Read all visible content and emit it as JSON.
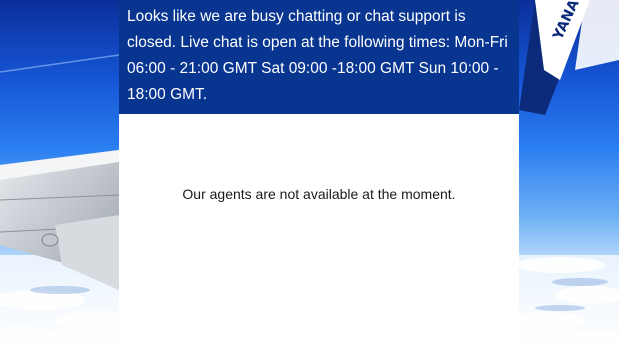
{
  "chat": {
    "closed_message": " Looks like we are busy chatting or chat support is closed. Live chat is open at the following times: Mon-Fri 06:00 - 21:00 GMT Sat 09:00 -18:00 GMT Sun 10:00 - 18:00 GMT.",
    "status_message": "Our agents are not available at the moment."
  },
  "colors": {
    "header_bg": "#073590",
    "sky": "#1554d4",
    "panel_bg": "#ffffff"
  }
}
